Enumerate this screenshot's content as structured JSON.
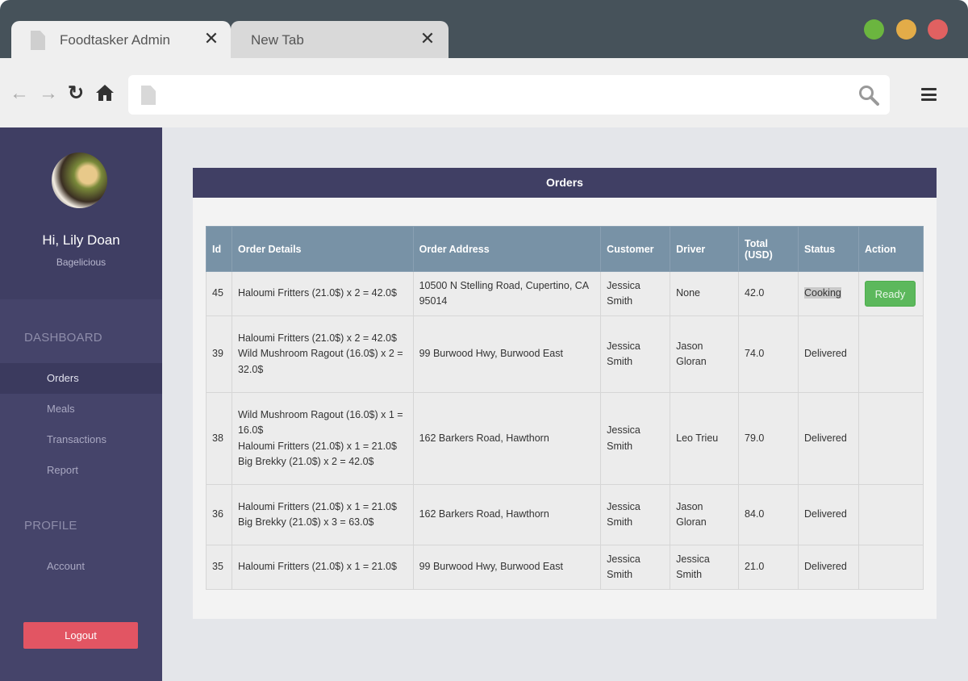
{
  "browser": {
    "tabs": [
      {
        "title": "Foodtasker Admin",
        "active": true
      },
      {
        "title": "New Tab",
        "active": false
      }
    ],
    "close_glyph": "✕",
    "nav": {
      "back": "←",
      "forward": "→",
      "reload": "↻",
      "home": "⌂"
    },
    "window_controls": {
      "green": "#6bb53f",
      "yellow": "#e3ac48",
      "red": "#e06161"
    }
  },
  "sidebar": {
    "greeting": "Hi, Lily Doan",
    "restaurant": "Bagelicious",
    "sections": [
      {
        "label": "DASHBOARD",
        "items": [
          {
            "label": "Orders",
            "active": true
          },
          {
            "label": "Meals",
            "active": false
          },
          {
            "label": "Transactions",
            "active": false
          },
          {
            "label": "Report",
            "active": false
          }
        ]
      },
      {
        "label": "PROFILE",
        "items": [
          {
            "label": "Account",
            "active": false
          }
        ]
      }
    ],
    "logout_label": "Logout"
  },
  "orders": {
    "title": "Orders",
    "columns": [
      "Id",
      "Order Details",
      "Order Address",
      "Customer",
      "Driver",
      "Total (USD)",
      "Status",
      "Action"
    ],
    "rows": [
      {
        "id": "45",
        "details": [
          "Haloumi Fritters (21.0$) x 2 = 42.0$"
        ],
        "address": "10500 N Stelling Road, Cupertino, CA 95014",
        "customer": "Jessica Smith",
        "driver": "None",
        "total": "42.0",
        "status": "Cooking",
        "action": "Ready"
      },
      {
        "id": "39",
        "details": [
          "Haloumi Fritters (21.0$) x 2 = 42.0$",
          "Wild Mushroom Ragout (16.0$) x 2 = 32.0$"
        ],
        "address": "99 Burwood Hwy, Burwood East",
        "customer": "Jessica Smith",
        "driver": "Jason Gloran",
        "total": "74.0",
        "status": "Delivered",
        "action": ""
      },
      {
        "id": "38",
        "details": [
          "Wild Mushroom Ragout (16.0$) x 1 = 16.0$",
          "Haloumi Fritters (21.0$) x 1 = 21.0$",
          "Big Brekky (21.0$) x 2 = 42.0$"
        ],
        "address": "162 Barkers Road, Hawthorn",
        "customer": "Jessica Smith",
        "driver": "Leo Trieu",
        "total": "79.0",
        "status": "Delivered",
        "action": ""
      },
      {
        "id": "36",
        "details": [
          "Haloumi Fritters (21.0$) x 1 = 21.0$",
          "Big Brekky (21.0$) x 3 = 63.0$"
        ],
        "address": "162 Barkers Road, Hawthorn",
        "customer": "Jessica Smith",
        "driver": "Jason Gloran",
        "total": "84.0",
        "status": "Delivered",
        "action": ""
      },
      {
        "id": "35",
        "details": [
          "Haloumi Fritters (21.0$) x 1 = 21.0$"
        ],
        "address": "99 Burwood Hwy, Burwood East",
        "customer": "Jessica Smith",
        "driver": "Jessica Smith",
        "total": "21.0",
        "status": "Delivered",
        "action": ""
      }
    ]
  }
}
